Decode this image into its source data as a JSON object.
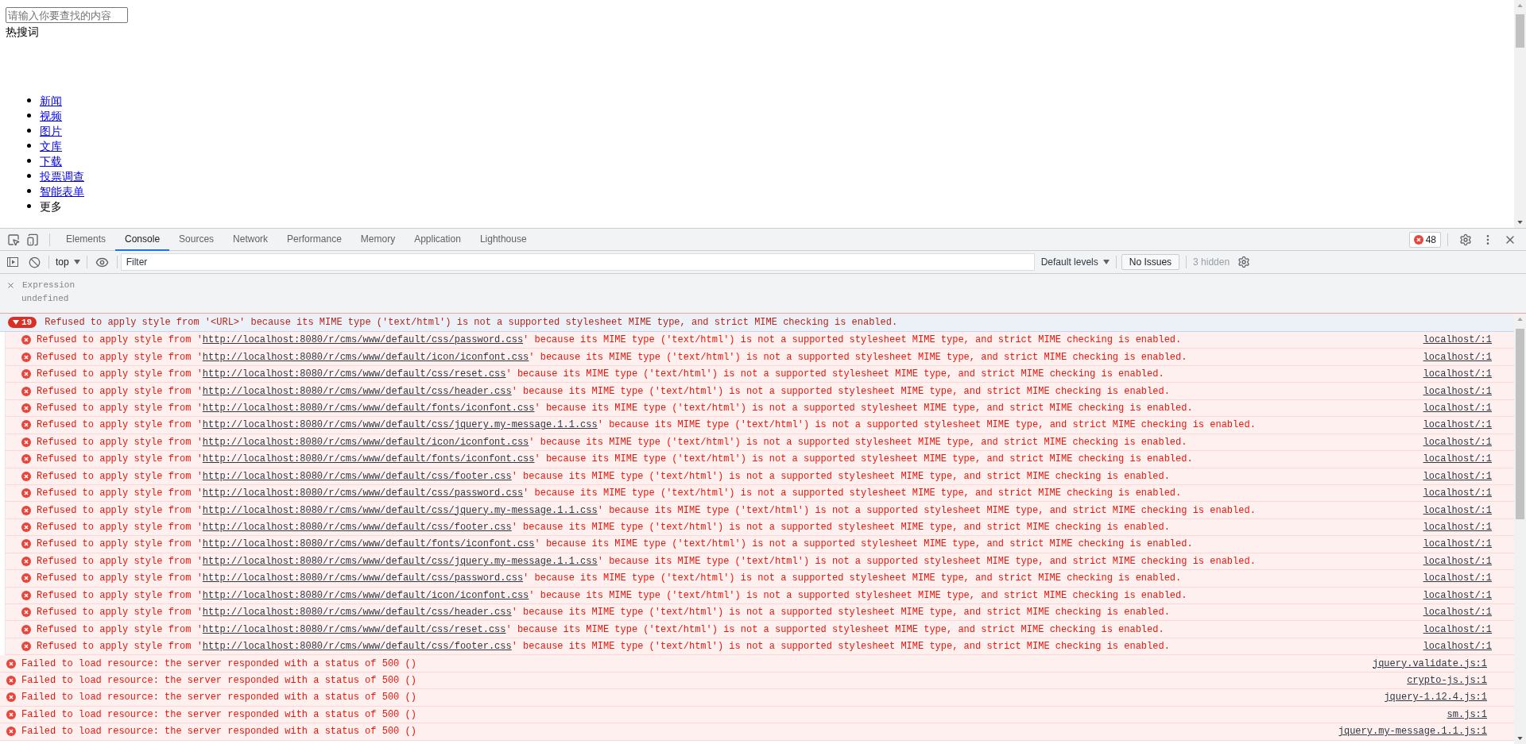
{
  "page": {
    "search": {
      "placeholder": "请输入你要查找的内容"
    },
    "hot_label": "热搜词",
    "nav": [
      {
        "label": "新闻",
        "kind": "link"
      },
      {
        "label": "视频",
        "kind": "link"
      },
      {
        "label": "图片",
        "kind": "link"
      },
      {
        "label": "文库",
        "kind": "link"
      },
      {
        "label": "下载",
        "kind": "link"
      },
      {
        "label": "投票调查",
        "kind": "link"
      },
      {
        "label": "智能表单",
        "kind": "link"
      },
      {
        "label": "更多",
        "kind": "text"
      }
    ]
  },
  "devtools": {
    "tabs": [
      {
        "label": "Elements",
        "selected": false
      },
      {
        "label": "Console",
        "selected": true
      },
      {
        "label": "Sources",
        "selected": false
      },
      {
        "label": "Network",
        "selected": false
      },
      {
        "label": "Performance",
        "selected": false
      },
      {
        "label": "Memory",
        "selected": false
      },
      {
        "label": "Application",
        "selected": false
      },
      {
        "label": "Lighthouse",
        "selected": false
      }
    ],
    "error_count": "48",
    "toolbar": {
      "context": "top",
      "filter_placeholder": "Filter",
      "levels": "Default levels",
      "issues": "No Issues",
      "hidden": "3 hidden"
    },
    "expression": {
      "label": "Expression",
      "value": "undefined"
    },
    "group": {
      "count": "19",
      "expanded": true,
      "message": "Refused to apply style from '<URL>' because its MIME type ('text/html') is not a supported stylesheet MIME type, and strict MIME checking is enabled.",
      "rows": [
        {
          "prefix": "Refused to apply style from '",
          "url": "http://localhost:8080/r/cms/www/default/css/password.css",
          "suffix": "' because its MIME type ('text/html') is not a supported stylesheet MIME type, and strict MIME checking is enabled.",
          "source": "localhost/:1"
        },
        {
          "prefix": "Refused to apply style from '",
          "url": "http://localhost:8080/r/cms/www/default/icon/iconfont.css",
          "suffix": "' because its MIME type ('text/html') is not a supported stylesheet MIME type, and strict MIME checking is enabled.",
          "source": "localhost/:1"
        },
        {
          "prefix": "Refused to apply style from '",
          "url": "http://localhost:8080/r/cms/www/default/css/reset.css",
          "suffix": "' because its MIME type ('text/html') is not a supported stylesheet MIME type, and strict MIME checking is enabled.",
          "source": "localhost/:1"
        },
        {
          "prefix": "Refused to apply style from '",
          "url": "http://localhost:8080/r/cms/www/default/css/header.css",
          "suffix": "' because its MIME type ('text/html') is not a supported stylesheet MIME type, and strict MIME checking is enabled.",
          "source": "localhost/:1"
        },
        {
          "prefix": "Refused to apply style from '",
          "url": "http://localhost:8080/r/cms/www/default/fonts/iconfont.css",
          "suffix": "' because its MIME type ('text/html') is not a supported stylesheet MIME type, and strict MIME checking is enabled.",
          "source": "localhost/:1"
        },
        {
          "prefix": "Refused to apply style from '",
          "url": "http://localhost:8080/r/cms/www/default/css/jquery.my-message.1.1.css",
          "suffix": "' because its MIME type ('text/html') is not a supported stylesheet MIME type, and strict MIME checking is enabled.",
          "source": "localhost/:1"
        },
        {
          "prefix": "Refused to apply style from '",
          "url": "http://localhost:8080/r/cms/www/default/icon/iconfont.css",
          "suffix": "' because its MIME type ('text/html') is not a supported stylesheet MIME type, and strict MIME checking is enabled.",
          "source": "localhost/:1"
        },
        {
          "prefix": "Refused to apply style from '",
          "url": "http://localhost:8080/r/cms/www/default/fonts/iconfont.css",
          "suffix": "' because its MIME type ('text/html') is not a supported stylesheet MIME type, and strict MIME checking is enabled.",
          "source": "localhost/:1"
        },
        {
          "prefix": "Refused to apply style from '",
          "url": "http://localhost:8080/r/cms/www/default/css/footer.css",
          "suffix": "' because its MIME type ('text/html') is not a supported stylesheet MIME type, and strict MIME checking is enabled.",
          "source": "localhost/:1"
        },
        {
          "prefix": "Refused to apply style from '",
          "url": "http://localhost:8080/r/cms/www/default/css/password.css",
          "suffix": "' because its MIME type ('text/html') is not a supported stylesheet MIME type, and strict MIME checking is enabled.",
          "source": "localhost/:1"
        },
        {
          "prefix": "Refused to apply style from '",
          "url": "http://localhost:8080/r/cms/www/default/css/jquery.my-message.1.1.css",
          "suffix": "' because its MIME type ('text/html') is not a supported stylesheet MIME type, and strict MIME checking is enabled.",
          "source": "localhost/:1"
        },
        {
          "prefix": "Refused to apply style from '",
          "url": "http://localhost:8080/r/cms/www/default/css/footer.css",
          "suffix": "' because its MIME type ('text/html') is not a supported stylesheet MIME type, and strict MIME checking is enabled.",
          "source": "localhost/:1"
        },
        {
          "prefix": "Refused to apply style from '",
          "url": "http://localhost:8080/r/cms/www/default/fonts/iconfont.css",
          "suffix": "' because its MIME type ('text/html') is not a supported stylesheet MIME type, and strict MIME checking is enabled.",
          "source": "localhost/:1"
        },
        {
          "prefix": "Refused to apply style from '",
          "url": "http://localhost:8080/r/cms/www/default/css/jquery.my-message.1.1.css",
          "suffix": "' because its MIME type ('text/html') is not a supported stylesheet MIME type, and strict MIME checking is enabled.",
          "source": "localhost/:1"
        },
        {
          "prefix": "Refused to apply style from '",
          "url": "http://localhost:8080/r/cms/www/default/css/password.css",
          "suffix": "' because its MIME type ('text/html') is not a supported stylesheet MIME type, and strict MIME checking is enabled.",
          "source": "localhost/:1"
        },
        {
          "prefix": "Refused to apply style from '",
          "url": "http://localhost:8080/r/cms/www/default/icon/iconfont.css",
          "suffix": "' because its MIME type ('text/html') is not a supported stylesheet MIME type, and strict MIME checking is enabled.",
          "source": "localhost/:1"
        },
        {
          "prefix": "Refused to apply style from '",
          "url": "http://localhost:8080/r/cms/www/default/css/header.css",
          "suffix": "' because its MIME type ('text/html') is not a supported stylesheet MIME type, and strict MIME checking is enabled.",
          "source": "localhost/:1"
        },
        {
          "prefix": "Refused to apply style from '",
          "url": "http://localhost:8080/r/cms/www/default/css/reset.css",
          "suffix": "' because its MIME type ('text/html') is not a supported stylesheet MIME type, and strict MIME checking is enabled.",
          "source": "localhost/:1"
        },
        {
          "prefix": "Refused to apply style from '",
          "url": "http://localhost:8080/r/cms/www/default/css/footer.css",
          "suffix": "' because its MIME type ('text/html') is not a supported stylesheet MIME type, and strict MIME checking is enabled.",
          "source": "localhost/:1"
        }
      ]
    },
    "errors": [
      {
        "message": "Failed to load resource: the server responded with a status of 500 ()",
        "source": "jquery.validate.js:1"
      },
      {
        "message": "Failed to load resource: the server responded with a status of 500 ()",
        "source": "crypto-js.js:1"
      },
      {
        "message": "Failed to load resource: the server responded with a status of 500 ()",
        "source": "jquery-1.12.4.js:1"
      },
      {
        "message": "Failed to load resource: the server responded with a status of 500 ()",
        "source": "sm.js:1"
      },
      {
        "message": "Failed to load resource: the server responded with a status of 500 ()",
        "source": "jquery.my-message.1.1.js:1"
      }
    ]
  }
}
